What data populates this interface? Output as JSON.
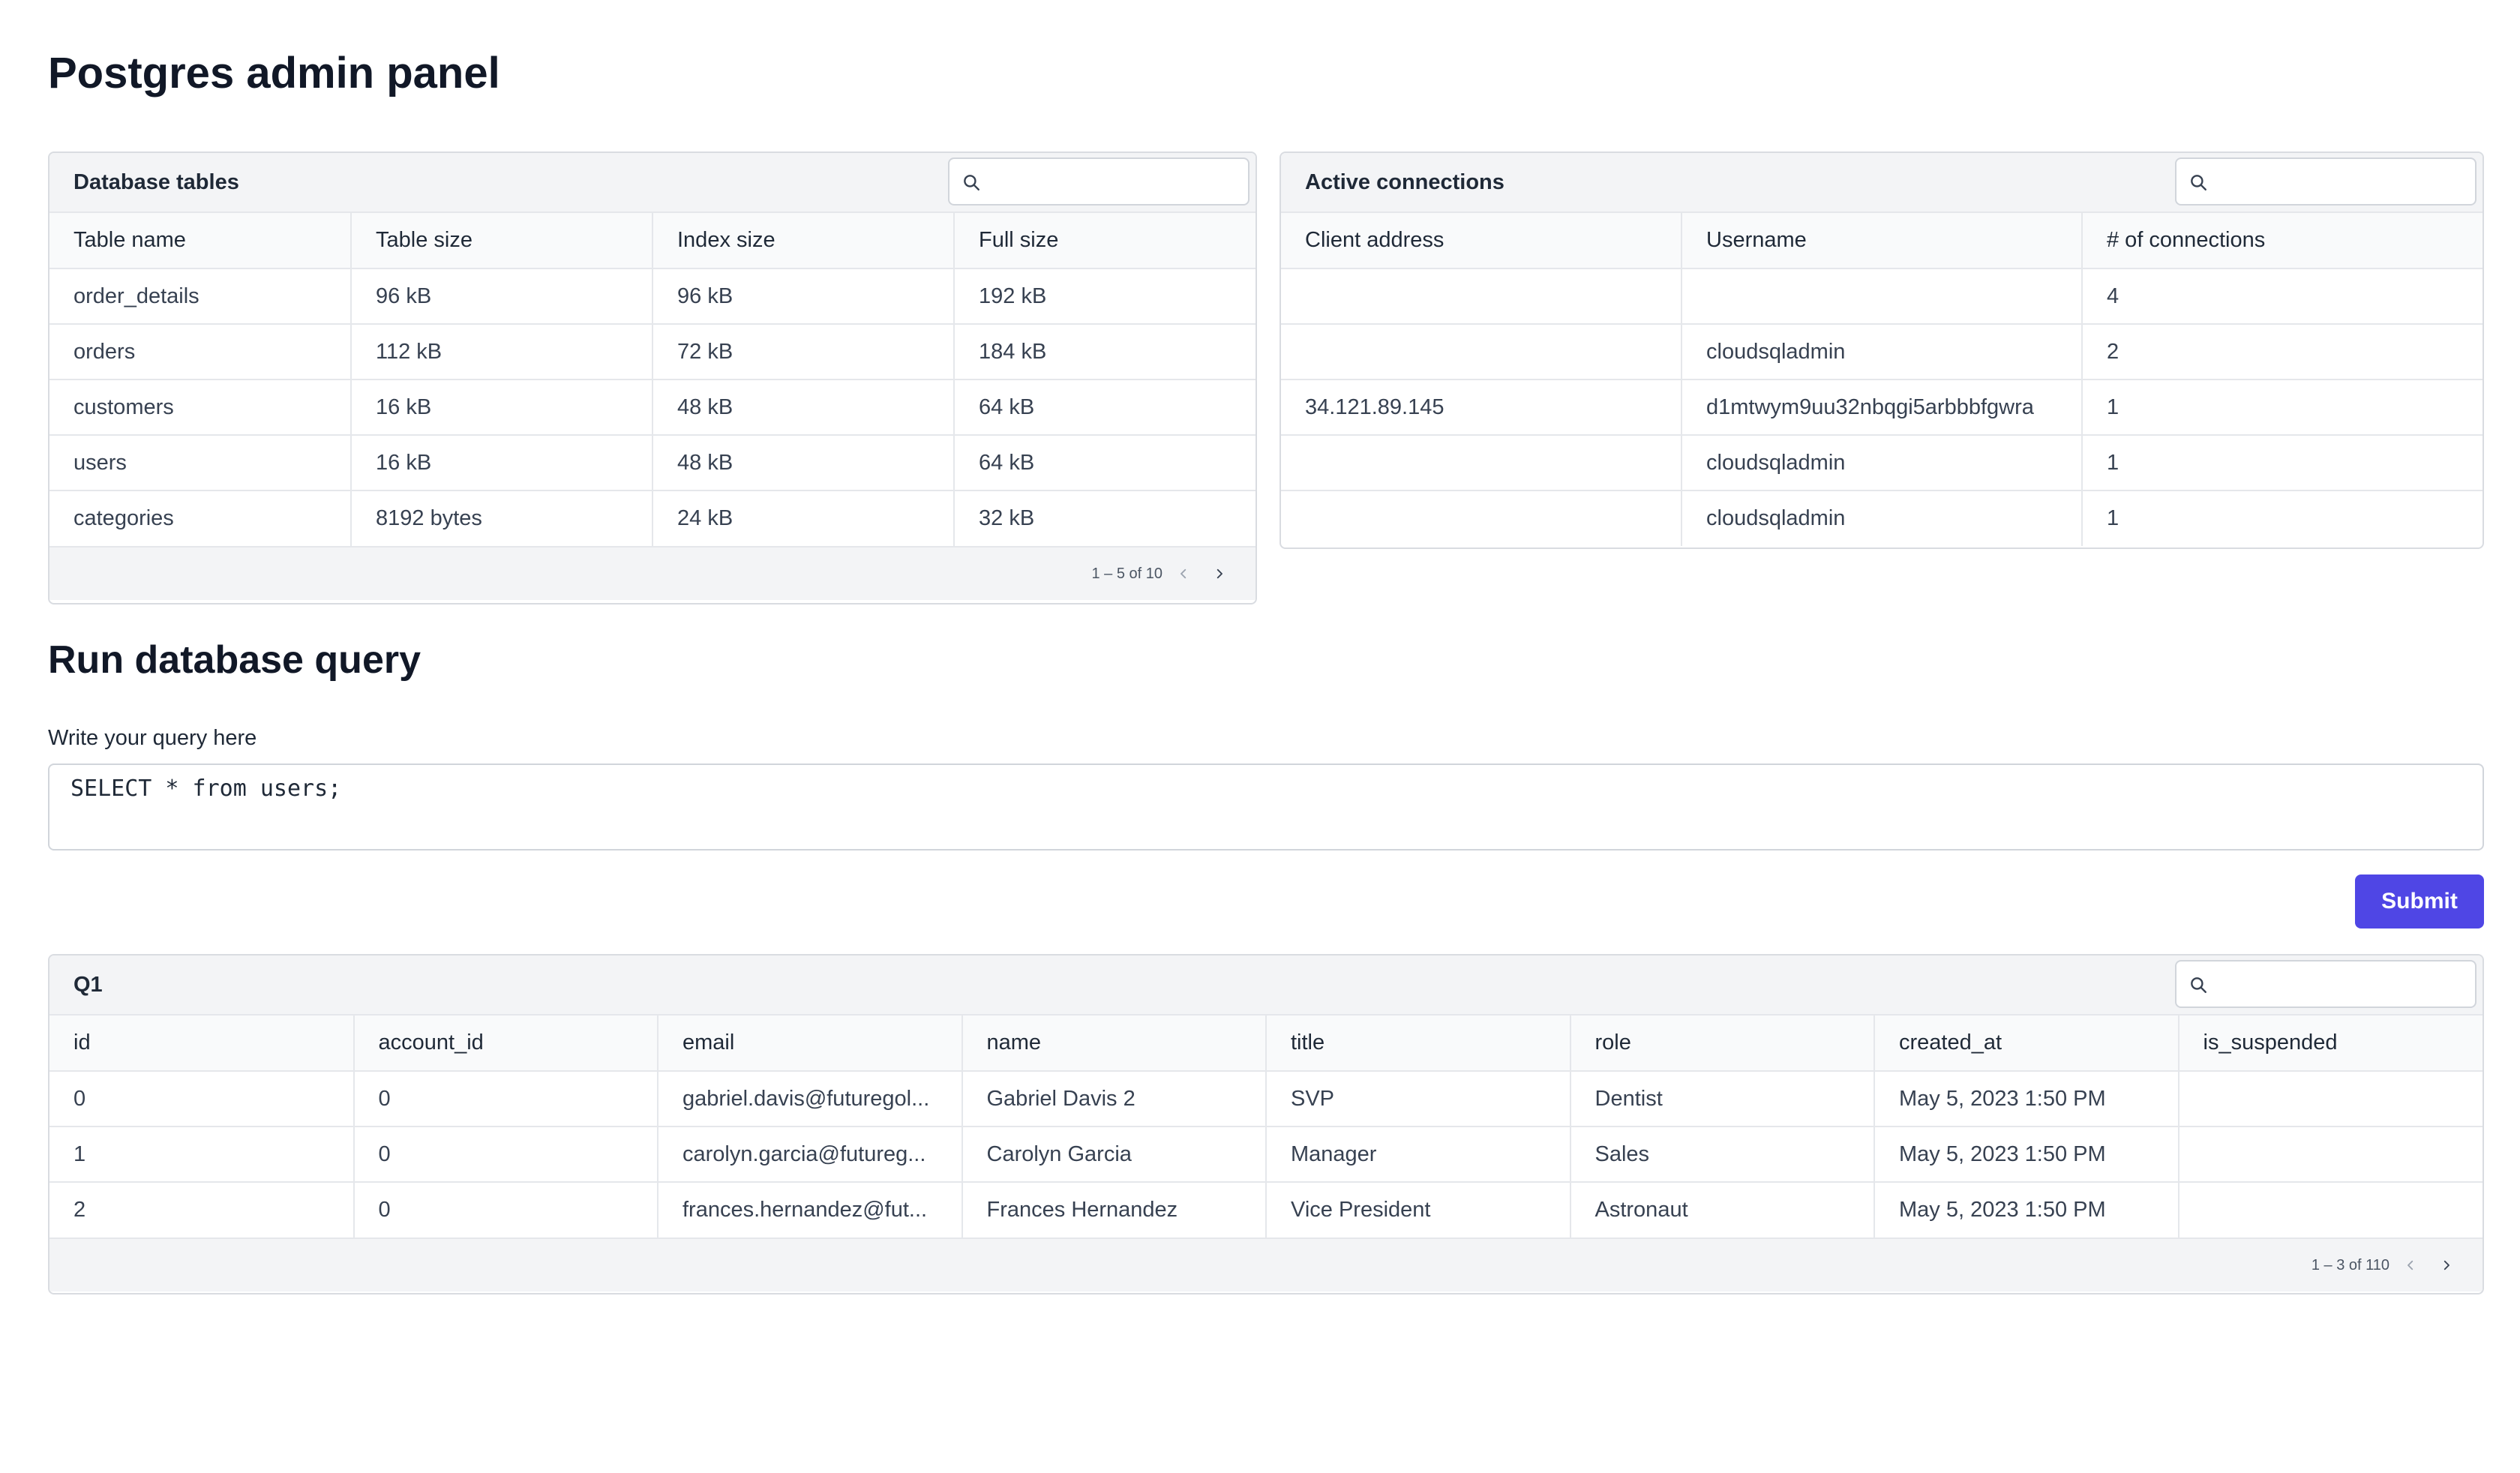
{
  "page_title": "Postgres admin panel",
  "tables_panel": {
    "title": "Database tables",
    "search_placeholder": "",
    "columns": [
      "Table name",
      "Table size",
      "Index size",
      "Full size"
    ],
    "rows": [
      [
        "order_details",
        "96 kB",
        "96 kB",
        "192 kB"
      ],
      [
        "orders",
        "112 kB",
        "72 kB",
        "184 kB"
      ],
      [
        "customers",
        "16 kB",
        "48 kB",
        "64 kB"
      ],
      [
        "users",
        "16 kB",
        "48 kB",
        "64 kB"
      ],
      [
        "categories",
        "8192 bytes",
        "24 kB",
        "32 kB"
      ]
    ],
    "pagination": "1 – 5 of 10"
  },
  "connections_panel": {
    "title": "Active connections",
    "search_placeholder": "",
    "columns": [
      "Client address",
      "Username",
      "# of connections"
    ],
    "rows": [
      [
        "",
        "",
        "4"
      ],
      [
        "",
        "cloudsqladmin",
        "2"
      ],
      [
        "34.121.89.145",
        "d1mtwym9uu32nbqgi5arbbbfgwra",
        "1"
      ],
      [
        "",
        "cloudsqladmin",
        "1"
      ],
      [
        "",
        "cloudsqladmin",
        "1"
      ]
    ]
  },
  "query_section": {
    "title": "Run database query",
    "label": "Write your query here",
    "query_value": "SELECT * from users;",
    "submit_label": "Submit"
  },
  "results_panel": {
    "title": "Q1",
    "search_placeholder": "",
    "columns": [
      "id",
      "account_id",
      "email",
      "name",
      "title",
      "role",
      "created_at",
      "is_suspended"
    ],
    "rows": [
      [
        "0",
        "0",
        "gabriel.davis@futuregol...",
        "Gabriel Davis 2",
        "SVP",
        "Dentist",
        "May 5, 2023 1:50 PM",
        ""
      ],
      [
        "1",
        "0",
        "carolyn.garcia@futureg...",
        "Carolyn Garcia",
        "Manager",
        "Sales",
        "May 5, 2023 1:50 PM",
        ""
      ],
      [
        "2",
        "0",
        "frances.hernandez@fut...",
        "Frances Hernandez",
        "Vice President",
        "Astronaut",
        "May 5, 2023 1:50 PM",
        ""
      ]
    ],
    "pagination": "1 – 3 of 110"
  },
  "icons": {
    "search": "search-icon",
    "prev": "chevron-left-icon",
    "next": "chevron-right-icon"
  },
  "colors": {
    "accent": "#4f46e5",
    "header_bg": "#f3f4f6",
    "border": "#e5e7eb"
  }
}
